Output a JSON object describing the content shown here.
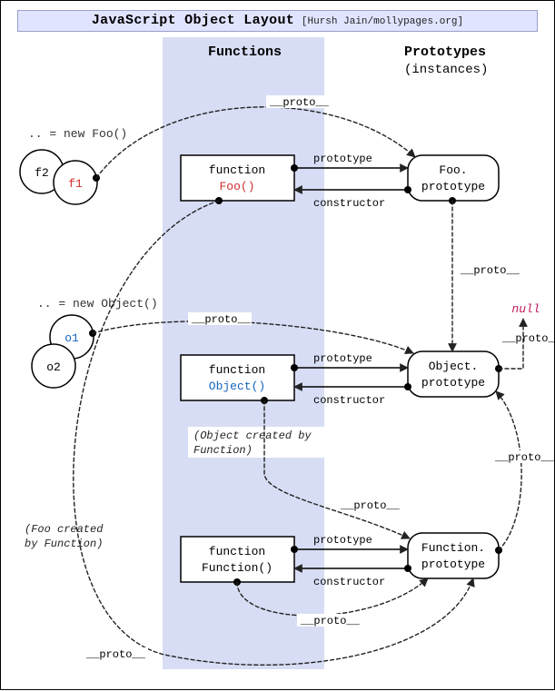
{
  "header": {
    "title": "JavaScript Object Layout",
    "credit": "[Hursh Jain/mollypages.org]"
  },
  "columns": {
    "functions": "Functions",
    "prototypes": "Prototypes",
    "prototypes_sub": "(instances)"
  },
  "boxes": {
    "foo": {
      "line1": "function",
      "line2": "Foo()"
    },
    "object": {
      "line1": "function",
      "line2": "Object()"
    },
    "function": {
      "line1": "function",
      "line2": "Function()"
    }
  },
  "chips": {
    "foo_proto": {
      "line1": "Foo.",
      "line2": "prototype"
    },
    "object_proto": {
      "line1": "Object.",
      "line2": "prototype"
    },
    "function_proto": {
      "line1": "Function.",
      "line2": "prototype"
    }
  },
  "instances": {
    "f1": "f1",
    "f2": "f2",
    "o1": "o1",
    "o2": "o2",
    "new_foo": ".. = new Foo()",
    "new_obj": ".. = new Object()"
  },
  "labels": {
    "proto": "__proto__",
    "prototype": "prototype",
    "constructor": "constructor"
  },
  "null": "null",
  "notes": {
    "object_by_function": {
      "l1": "(Object created by",
      "l2": "Function)"
    },
    "foo_by_function": {
      "l1": "(Foo created",
      "l2": "by Function)"
    }
  }
}
